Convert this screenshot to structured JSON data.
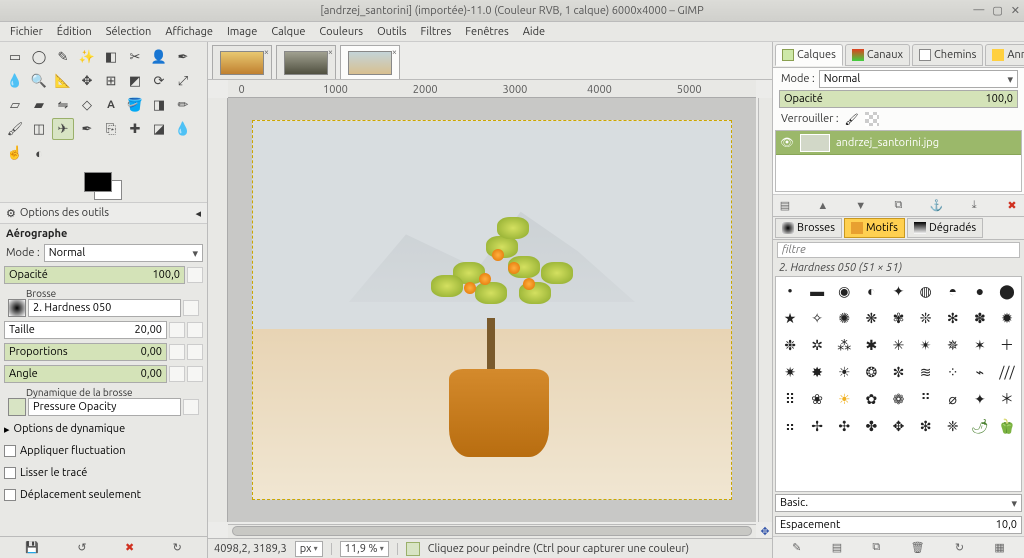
{
  "window": {
    "title": "[andrzej_santorini] (importée)-11.0 (Couleur RVB, 1 calque) 6000x4000 – GIMP",
    "min": "—",
    "max": "▢",
    "close": "✕"
  },
  "menu": [
    "Fichier",
    "Édition",
    "Sélection",
    "Affichage",
    "Image",
    "Calque",
    "Couleurs",
    "Outils",
    "Filtres",
    "Fenêtres",
    "Aide"
  ],
  "toolbox": {
    "options_title": "Options des outils",
    "section": "Aérographe",
    "mode_label": "Mode :",
    "mode_value": "Normal",
    "opacity_label": "Opacité",
    "opacity_value": "100,0",
    "brush_label": "Brosse",
    "brush_value": "2. Hardness 050",
    "size_label": "Taille",
    "size_value": "20,00",
    "ratio_label": "Proportions",
    "ratio_value": "0,00",
    "angle_label": "Angle",
    "angle_value": "0,00",
    "dyn_label": "Dynamique de la brosse",
    "dyn_value": "Pressure Opacity",
    "dyn_opts": "Options de dynamique",
    "chk1": "Appliquer fluctuation",
    "chk2": "Lisser le tracé",
    "chk3": "Déplacement seulement"
  },
  "ruler_marks": [
    "0",
    "1000",
    "2000",
    "3000",
    "4000",
    "5000"
  ],
  "status": {
    "coords": "4098,2, 3189,3",
    "unit": "px",
    "zoom": "11,9 %",
    "hint": "Cliquez pour peindre (Ctrl pour capturer une couleur)"
  },
  "right": {
    "tabs": [
      "Calques",
      "Canaux",
      "Chemins",
      "Annuler"
    ],
    "mode_label": "Mode :",
    "mode_value": "Normal",
    "opacity_label": "Opacité",
    "opacity_value": "100,0",
    "lock_label": "Verrouiller :",
    "layer_name": "andrzej_santorini.jpg",
    "mid_tabs": [
      "Brosses",
      "Motifs",
      "Dégradés"
    ],
    "filter_ph": "filtre",
    "brush_title": "2. Hardness 050 (51 × 51)",
    "basic": "Basic.",
    "spacing_label": "Espacement",
    "spacing_value": "10,0"
  }
}
